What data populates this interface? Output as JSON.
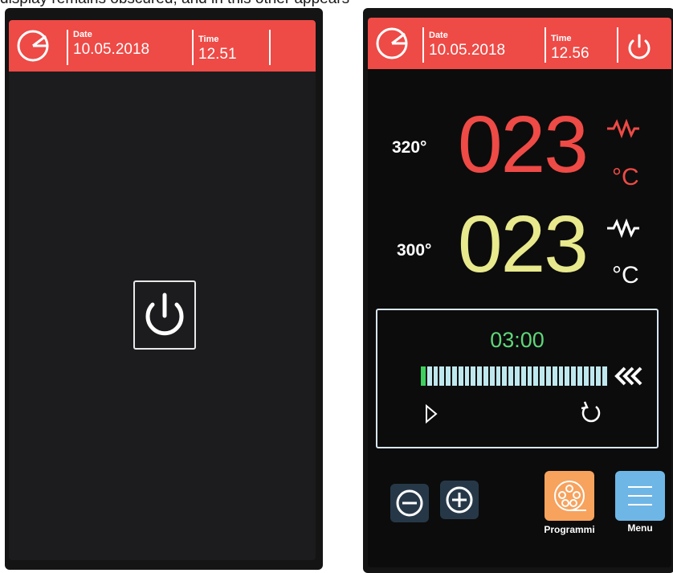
{
  "caption": "display remains obscured, and in this other appears",
  "left_screen": {
    "header": {
      "date_label": "Date",
      "date_value": "10.05.2018",
      "time_label": "Time",
      "time_value": "12.51"
    },
    "icons": {
      "clock": "clock-icon",
      "power": "power-icon"
    }
  },
  "right_screen": {
    "header": {
      "date_label": "Date",
      "date_value": "10.05.2018",
      "time_label": "Time",
      "time_value": "12.56"
    },
    "top": {
      "setpoint": "320°",
      "value": "023",
      "unit": "°C",
      "color": "#ee4a46"
    },
    "bottom": {
      "setpoint": "300°",
      "value": "023",
      "unit": "°C",
      "color": "#e8e98c"
    },
    "timer": {
      "value": "03:00",
      "progress": 0.04,
      "segments": 30
    },
    "buttons": {
      "programs_label": "Programmi",
      "menu_label": "Menu"
    },
    "colors": {
      "header": "#ee4a46",
      "programs": "#f7a25d",
      "menu": "#6eb6e6",
      "timer_text": "#5fd67a"
    },
    "icons": [
      "clock-icon",
      "power-icon",
      "heater-icon",
      "play-icon",
      "reset-icon",
      "rewind-icon",
      "minus-icon",
      "plus-icon",
      "program-reel-icon",
      "menu-lines-icon"
    ]
  }
}
